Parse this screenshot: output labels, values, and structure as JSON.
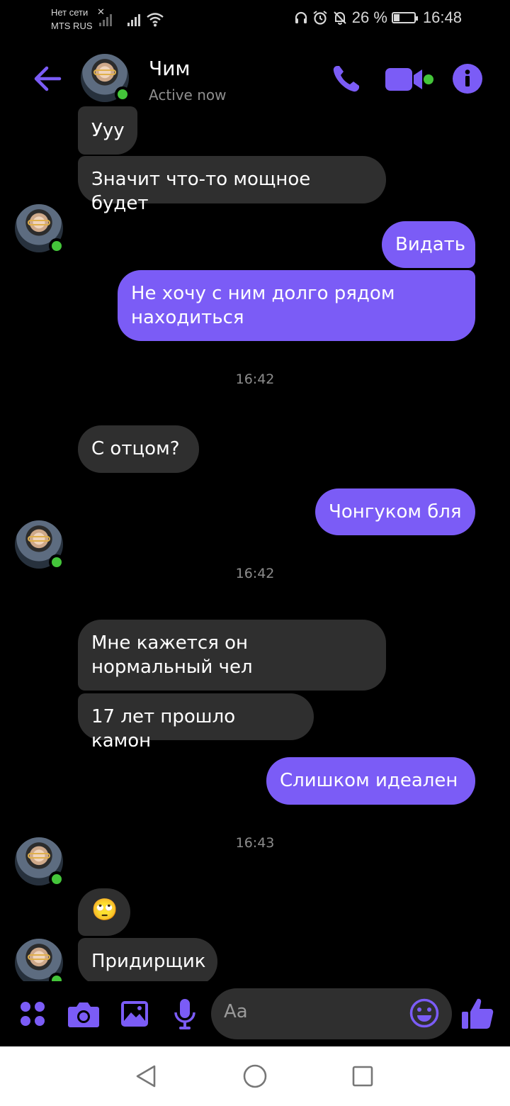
{
  "status_bar": {
    "no_network": "Нет сети",
    "carrier": "MTS RUS",
    "battery": "26 %",
    "battery_level": 0.26,
    "time": "16:48"
  },
  "header": {
    "name": "Чим",
    "status": "Active now"
  },
  "messages": [
    {
      "from": "them",
      "text": "Ууу"
    },
    {
      "from": "them",
      "text": "Значит что-то мощное будет"
    },
    {
      "from": "me",
      "text": "Видать"
    },
    {
      "from": "me",
      "text": "Не хочу с ним долго рядом находиться"
    },
    {
      "time": "16:42"
    },
    {
      "from": "them",
      "text": "С отцом?"
    },
    {
      "from": "me",
      "text": "Чонгуком бля"
    },
    {
      "time": "16:42"
    },
    {
      "from": "them",
      "text": "Мне кажется он нормальный чел"
    },
    {
      "from": "them",
      "text": "17 лет прошло камон"
    },
    {
      "from": "me",
      "text": "Слишком идеален"
    },
    {
      "time": "16:43"
    },
    {
      "from": "them",
      "emoji": "🙄"
    },
    {
      "from": "them",
      "text": "Придирщик"
    }
  ],
  "composer": {
    "placeholder": "Aa"
  },
  "colors": {
    "accent": "#7b5cf6",
    "incoming_bubble": "#2f2f2f",
    "online": "#44c53a"
  },
  "icons": [
    "back-arrow-icon",
    "phone-icon",
    "video-camera-icon",
    "info-icon",
    "apps-icon",
    "camera-icon",
    "gallery-icon",
    "microphone-icon",
    "emoji-icon",
    "thumbs-up-icon"
  ]
}
